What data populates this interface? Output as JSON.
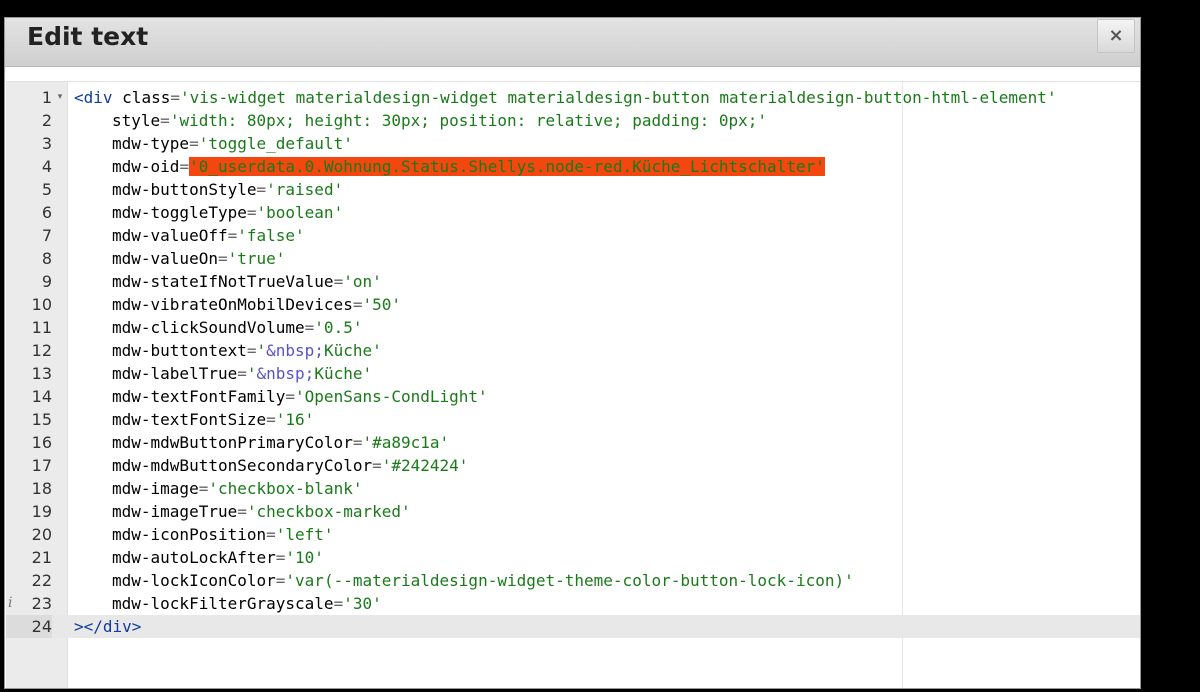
{
  "dialog": {
    "title": "Edit text",
    "close_label": "×"
  },
  "editor": {
    "info_marker": "i",
    "fold_marker": "▾",
    "lines": [
      {
        "num": "1",
        "tag_open": "<div",
        "attr": "class",
        "value": "'vis-widget materialdesign-widget materialdesign-button materialdesign-button-html-element'"
      },
      {
        "num": "2",
        "attr": "style",
        "value": "'width: 80px; height: 30px; position: relative; padding: 0px;'"
      },
      {
        "num": "3",
        "attr": "mdw-type",
        "value": "'toggle_default'"
      },
      {
        "num": "4",
        "attr": "mdw-oid",
        "value": "'0_userdata.0.Wohnung.Status.Shellys.node-red.Küche_Lichtschalter'"
      },
      {
        "num": "5",
        "attr": "mdw-buttonStyle",
        "value": "'raised'"
      },
      {
        "num": "6",
        "attr": "mdw-toggleType",
        "value": "'boolean'"
      },
      {
        "num": "7",
        "attr": "mdw-valueOff",
        "value": "'false'"
      },
      {
        "num": "8",
        "attr": "mdw-valueOn",
        "value": "'true'"
      },
      {
        "num": "9",
        "attr": "mdw-stateIfNotTrueValue",
        "value": "'on'"
      },
      {
        "num": "10",
        "attr": "mdw-vibrateOnMobilDevices",
        "value": "'50'"
      },
      {
        "num": "11",
        "attr": "mdw-clickSoundVolume",
        "value": "'0.5'"
      },
      {
        "num": "12",
        "attr": "mdw-buttontext",
        "value_pre": "'",
        "entity": "&nbsp;",
        "value_post": "Küche'"
      },
      {
        "num": "13",
        "attr": "mdw-labelTrue",
        "value_pre": "'",
        "entity": "&nbsp;",
        "value_post": "Küche'"
      },
      {
        "num": "14",
        "attr": "mdw-textFontFamily",
        "value": "'OpenSans-CondLight'"
      },
      {
        "num": "15",
        "attr": "mdw-textFontSize",
        "value": "'16'"
      },
      {
        "num": "16",
        "attr": "mdw-mdwButtonPrimaryColor",
        "value": "'#a89c1a'"
      },
      {
        "num": "17",
        "attr": "mdw-mdwButtonSecondaryColor",
        "value": "'#242424'"
      },
      {
        "num": "18",
        "attr": "mdw-image",
        "value": "'checkbox-blank'"
      },
      {
        "num": "19",
        "attr": "mdw-imageTrue",
        "value": "'checkbox-marked'"
      },
      {
        "num": "20",
        "attr": "mdw-iconPosition",
        "value": "'left'"
      },
      {
        "num": "21",
        "attr": "mdw-autoLockAfter",
        "value": "'10'"
      },
      {
        "num": "22",
        "attr": "mdw-lockIconColor",
        "value": "'var(--materialdesign-widget-theme-color-button-lock-icon)'"
      },
      {
        "num": "23",
        "attr": "mdw-lockFilterGrayscale",
        "value": "'30'"
      },
      {
        "num": "24",
        "tag_close": "></div>"
      }
    ],
    "eq": "=",
    "highlight_color": "#f4470f"
  }
}
